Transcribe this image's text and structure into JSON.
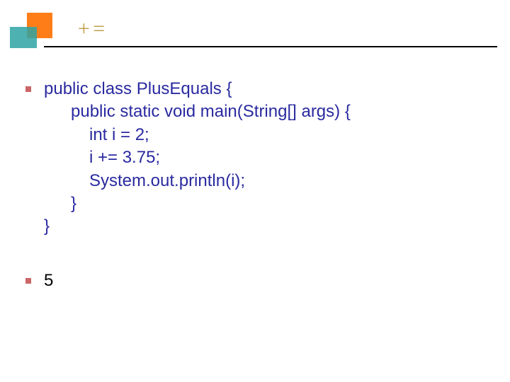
{
  "title": "+=",
  "code": {
    "l1": "public class PlusEquals {",
    "l2": "public static void main(String[] args) {",
    "l3": "int i = 2;",
    "l4": "i += 3.75;",
    "l5": "System.out.println(i);",
    "l6": "}",
    "l7": "}"
  },
  "answer": "5"
}
